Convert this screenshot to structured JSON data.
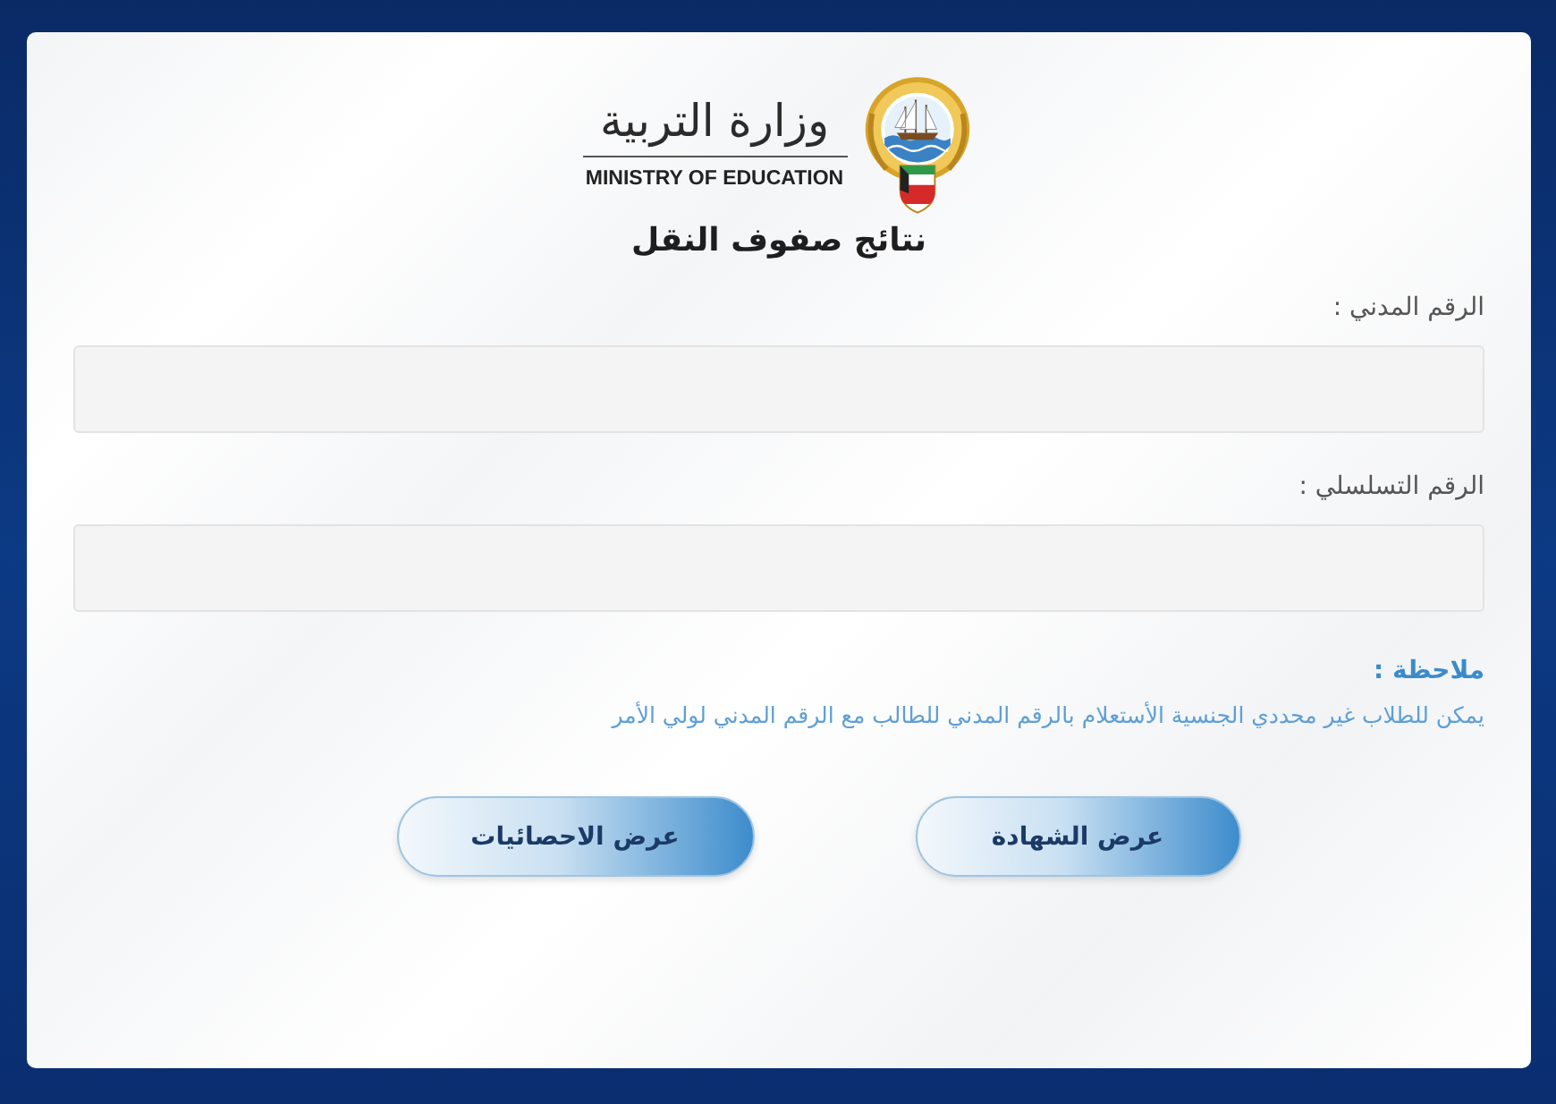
{
  "header": {
    "logo_text": "وزارة التربية",
    "logo_subtitle": "MINISTRY OF EDUCATION",
    "title": "نتائج صفوف النقل"
  },
  "fields": [
    {
      "label": "الرقم المدني :"
    },
    {
      "label": "الرقم التسلسلي :"
    }
  ],
  "note": {
    "heading": "ملاحظة :",
    "text": "يمكن للطلاب غير محددي الجنسية الأستعلام بالرقم المدني للطالب مع الرقم المدني لولي الأمر"
  },
  "buttons": [
    "عرض الشهادة",
    "عرض الاحصائيات"
  ]
}
